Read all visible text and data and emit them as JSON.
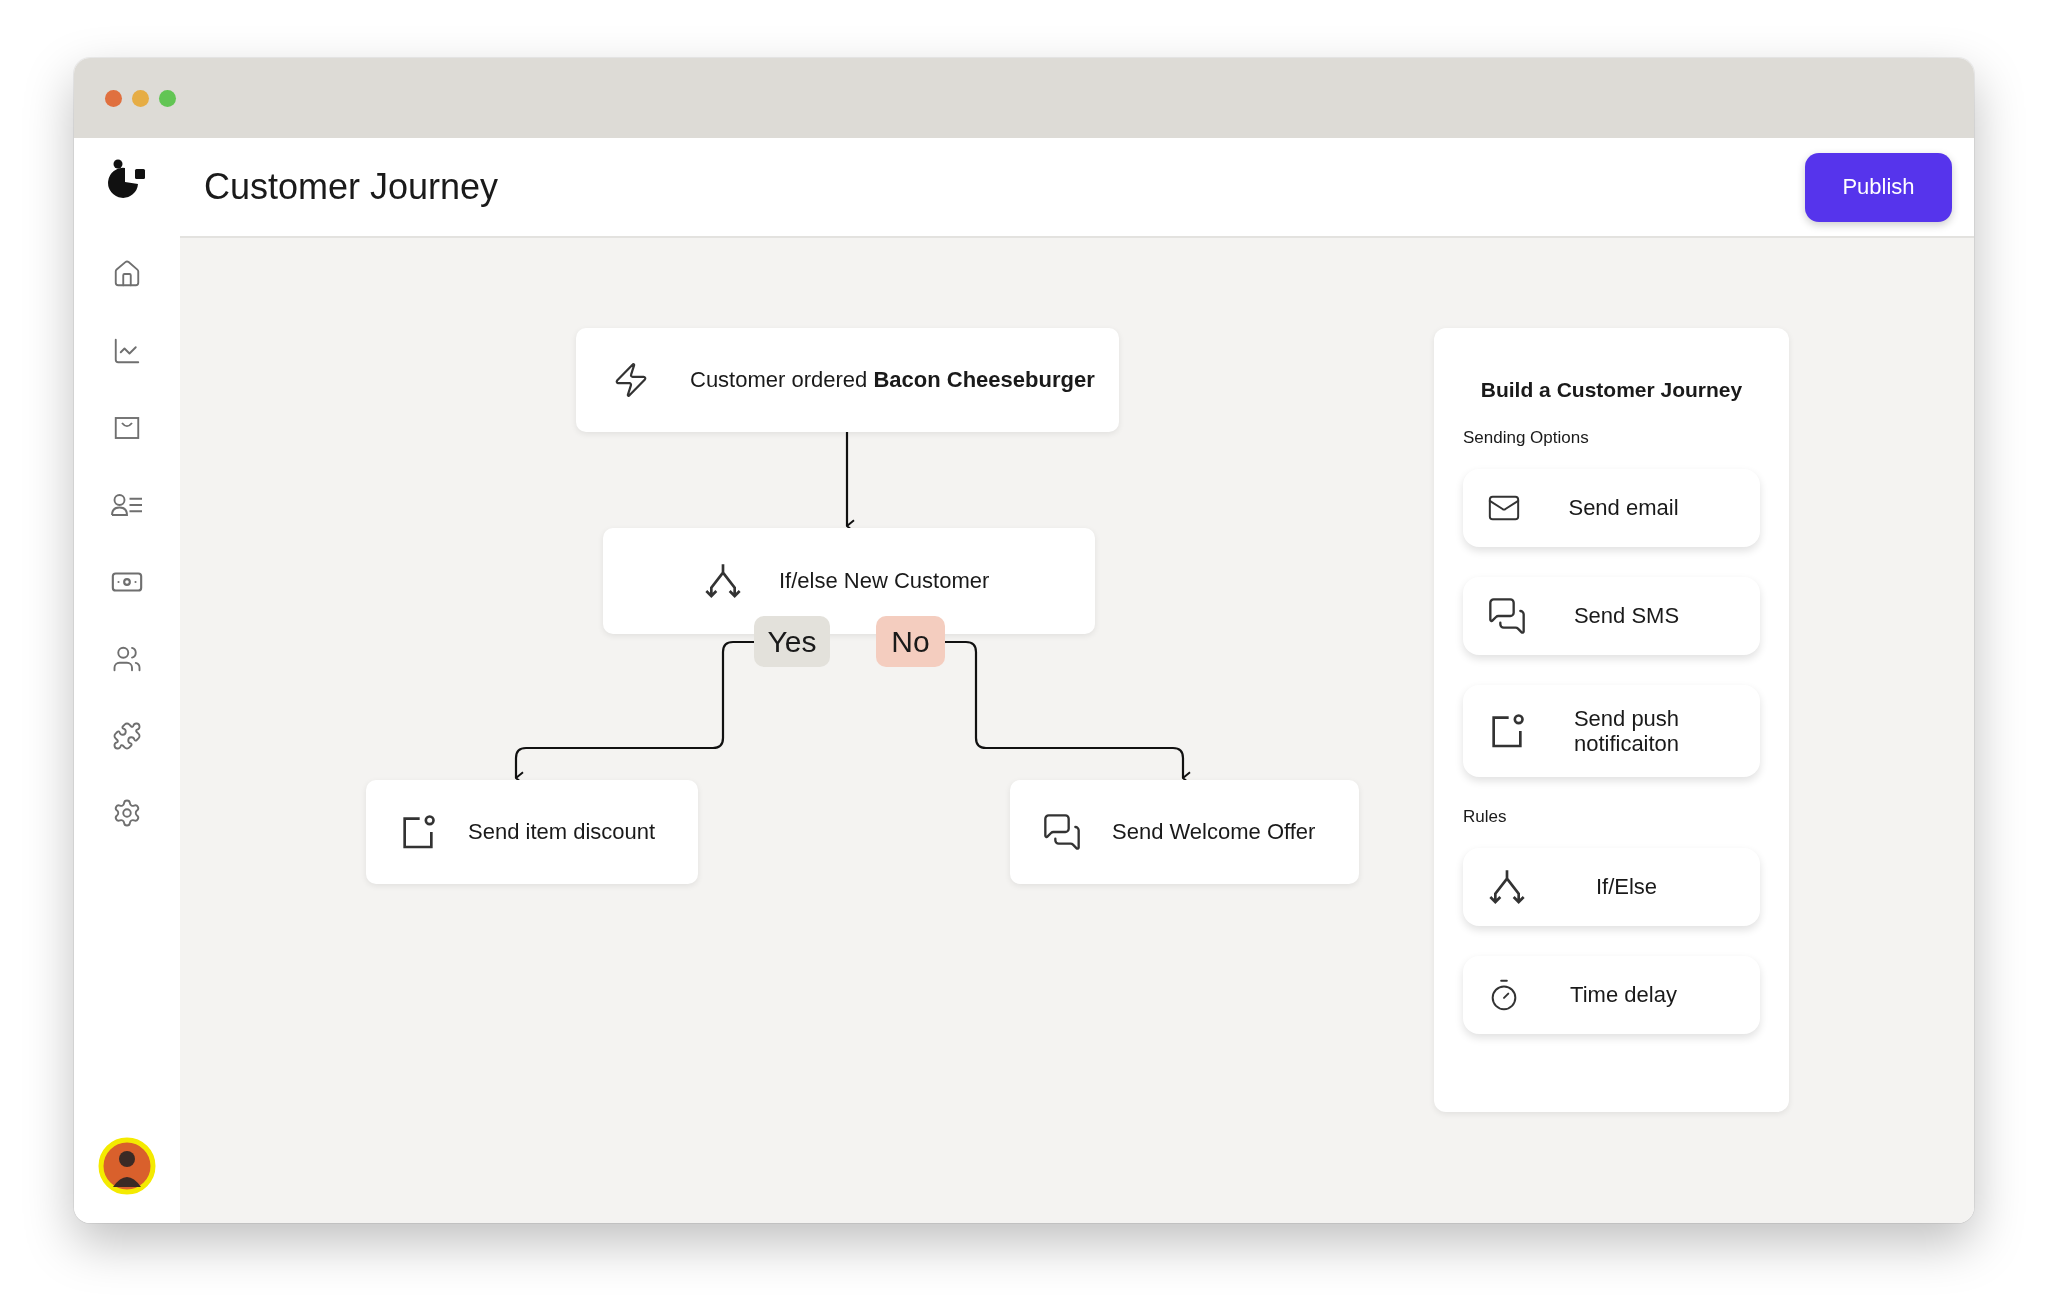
{
  "page_title": "Customer Journey",
  "publish_button": "Publish",
  "sidebar": {
    "items": [
      {
        "kind": "home"
      },
      {
        "kind": "chart"
      },
      {
        "kind": "bag"
      },
      {
        "kind": "contacts"
      },
      {
        "kind": "money"
      },
      {
        "kind": "users"
      },
      {
        "kind": "puzzle"
      },
      {
        "kind": "settings"
      }
    ]
  },
  "flow": {
    "nodes": [
      {
        "kind": "trigger",
        "text": "Customer ordered **Bacon Cheeseburger**"
      },
      {
        "kind": "split",
        "text": "If/else New Customer"
      },
      {
        "kind": "push",
        "text": "Send item discount"
      },
      {
        "kind": "sms",
        "text": "Send Welcome Offer"
      }
    ],
    "branches": [
      {
        "label": "Yes",
        "color": "#e3e1db"
      },
      {
        "label": "No",
        "color": "#f4cdbf"
      }
    ]
  },
  "panel": {
    "title": "Build a Customer Journey",
    "sections": [
      {
        "title": "Sending Options",
        "options": [
          {
            "kind": "email",
            "label": "Send email"
          },
          {
            "kind": "sms",
            "label": "Send SMS"
          },
          {
            "kind": "push",
            "label": "Send push notificaiton"
          }
        ]
      },
      {
        "title": "Rules",
        "options": [
          {
            "kind": "split",
            "label": "If/Else"
          },
          {
            "kind": "delay",
            "label": "Time delay"
          }
        ]
      }
    ]
  }
}
